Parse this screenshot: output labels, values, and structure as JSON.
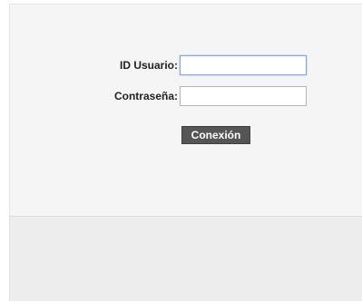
{
  "login": {
    "user_label": "ID Usuario:",
    "user_value": "",
    "password_label": "Contraseña:",
    "password_value": "",
    "submit_label": "Conexión"
  },
  "colors": {
    "panel_background": "#f5f5f5",
    "footer_background": "#ededed",
    "button_background": "#555555",
    "button_text": "#ffffff",
    "focus_border": "#7aa7e0"
  }
}
